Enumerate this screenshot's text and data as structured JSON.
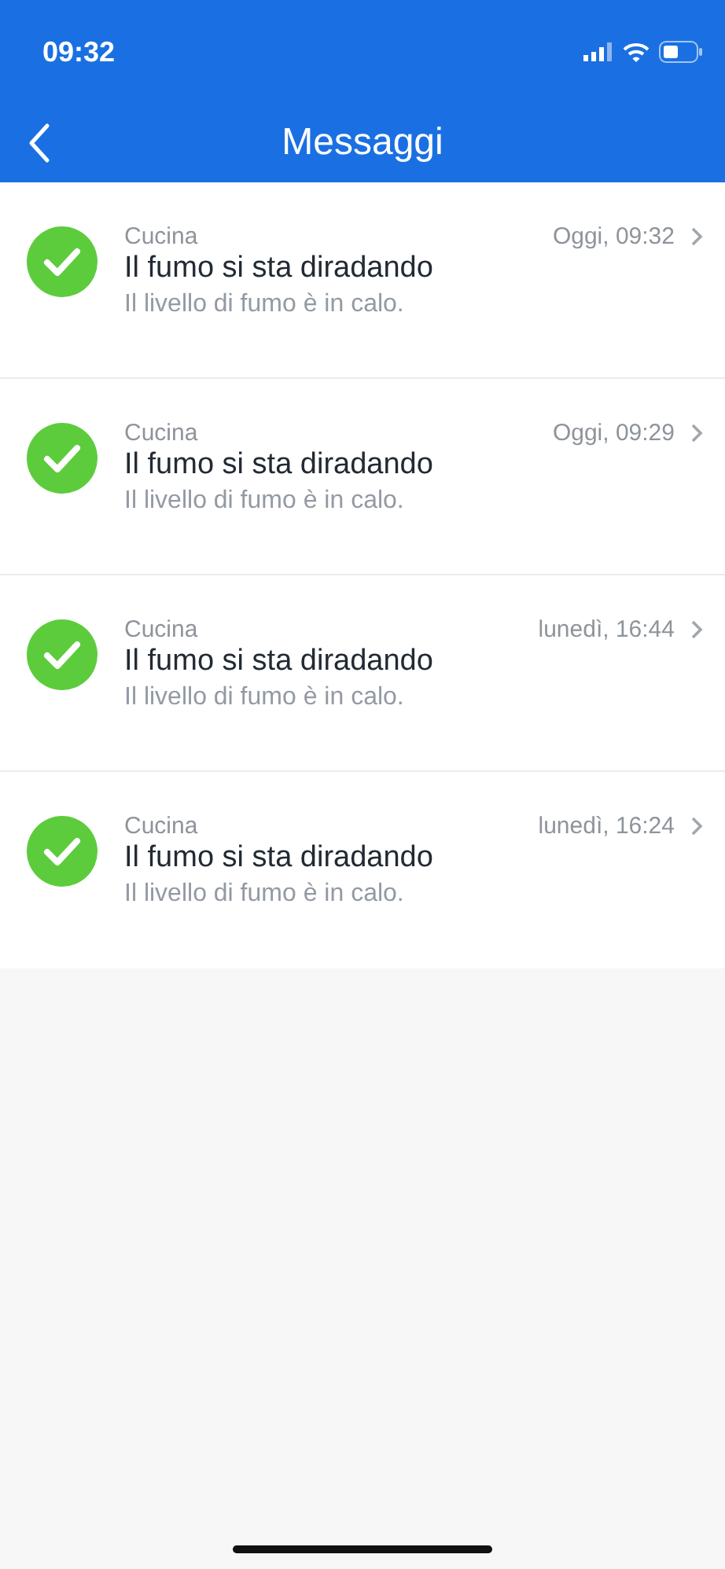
{
  "status_bar": {
    "time": "09:32"
  },
  "nav": {
    "title": "Messaggi"
  },
  "messages": [
    {
      "kind": "ok",
      "room": "Cucina",
      "title": "Il fumo si sta diradando",
      "body": "Il livello di fumo è in calo.",
      "time": "Oggi, 09:32"
    },
    {
      "kind": "ok",
      "room": "Cucina",
      "title": "Il fumo si sta diradando",
      "body": "Il livello di fumo è in calo.",
      "time": "Oggi, 09:29"
    },
    {
      "kind": "ok",
      "room": "Cucina",
      "title": "Il fumo si sta diradando",
      "body": "Il livello di fumo è in calo.",
      "time": "lunedì, 16:44"
    },
    {
      "kind": "ok",
      "room": "Cucina",
      "title": "Il fumo si sta diradando",
      "body": "Il livello di fumo è in calo.",
      "time": "lunedì, 16:24"
    }
  ]
}
